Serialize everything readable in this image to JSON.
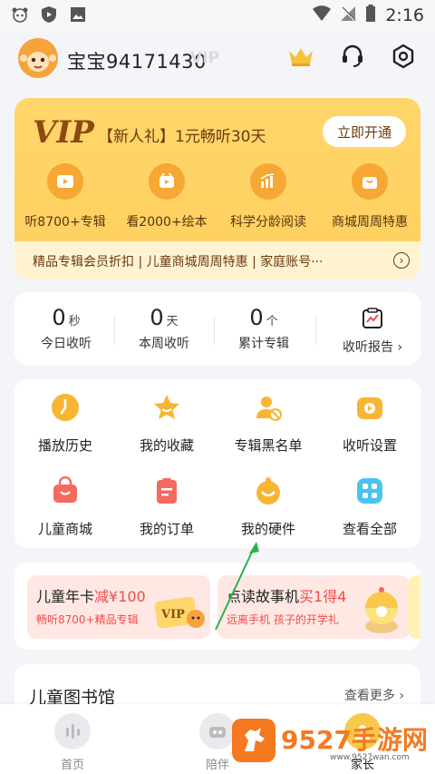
{
  "status_bar": {
    "time": "2:16"
  },
  "profile": {
    "username": "宝宝94171430",
    "ghost_text": "VIP"
  },
  "vip_card": {
    "logo": "VIP",
    "promo": "【新人礼】1元畅听30天",
    "open_button": "立即开通",
    "benefits": [
      {
        "label": "听8700+专辑",
        "icon": "play-icon"
      },
      {
        "label": "看2000+绘本",
        "icon": "picturebook-icon"
      },
      {
        "label": "科学分龄阅读",
        "icon": "chart-icon"
      },
      {
        "label": "商城周周特惠",
        "icon": "shopping-bag-icon"
      }
    ],
    "marquee": "精品专辑会员折扣  |  儿童商城周周特惠  |  家庭账号···"
  },
  "stats": {
    "items": [
      {
        "value": "0",
        "unit": "秒",
        "label": "今日收听"
      },
      {
        "value": "0",
        "unit": "天",
        "label": "本周收听"
      },
      {
        "value": "0",
        "unit": "个",
        "label": "累计专辑"
      }
    ],
    "report_label": "收听报告 ›"
  },
  "grid": {
    "items": [
      {
        "label": "播放历史",
        "icon": "history-icon"
      },
      {
        "label": "我的收藏",
        "icon": "star-icon"
      },
      {
        "label": "专辑黑名单",
        "icon": "blacklist-icon"
      },
      {
        "label": "收听设置",
        "icon": "listen-settings-icon"
      },
      {
        "label": "儿童商城",
        "icon": "shop-icon"
      },
      {
        "label": "我的订单",
        "icon": "order-icon"
      },
      {
        "label": "我的硬件",
        "icon": "hardware-icon"
      },
      {
        "label": "查看全部",
        "icon": "all-icon"
      }
    ]
  },
  "banners": [
    {
      "title_prefix": "儿童年卡",
      "title_highlight": "减¥100",
      "subtitle": "畅听8700+精品专辑"
    },
    {
      "title_prefix": "点读故事机",
      "title_highlight": "买1得4",
      "subtitle": "远离手机 孩子的开学礼"
    }
  ],
  "library": {
    "title": "儿童图书馆",
    "more": "查看更多 ›"
  },
  "tabs": [
    {
      "label": "首页"
    },
    {
      "label": "陪伴"
    },
    {
      "label": "家长"
    }
  ],
  "watermark": {
    "text": "9527手游网",
    "url": "www.9527wan.com"
  },
  "colors": {
    "vip_gold": "#ffd66b",
    "accent_orange": "#f7a733",
    "red": "#f04b4b",
    "watermark": "#f47920"
  }
}
